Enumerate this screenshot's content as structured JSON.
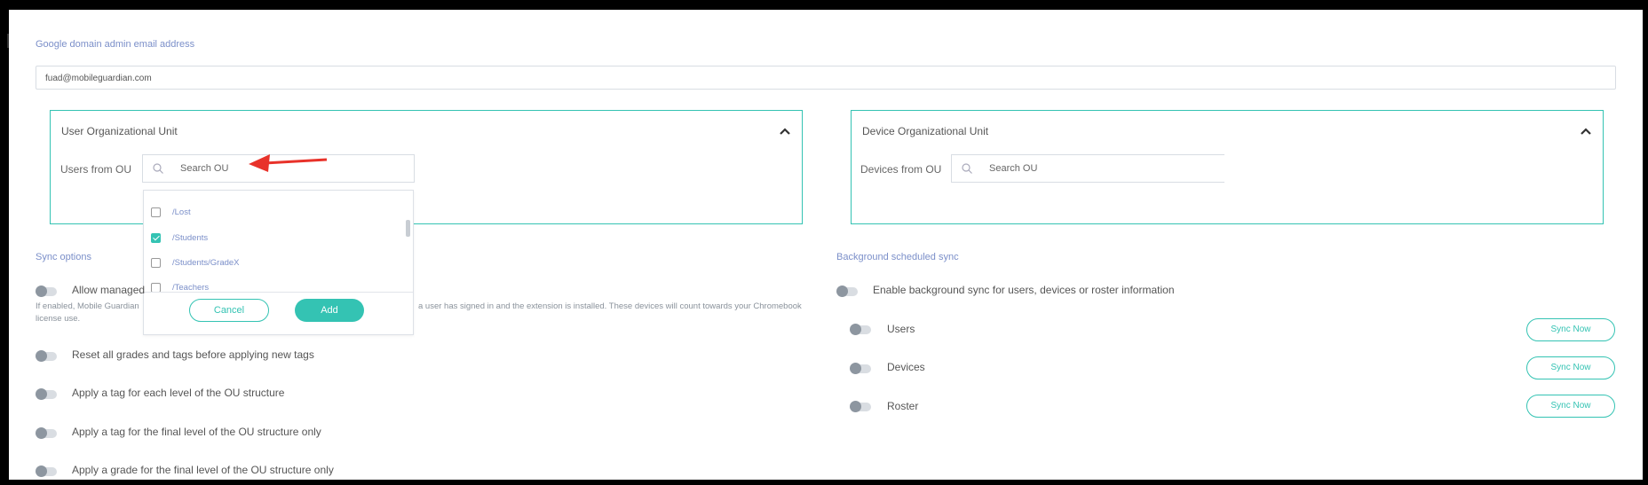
{
  "google": {
    "email_label": "Google domain admin email address",
    "email_value": "fuad@mobileguardian.com"
  },
  "user_ou": {
    "title": "User Organizational Unit",
    "field_label": "Users from OU",
    "search_placeholder": "Search OU",
    "options": [
      {
        "label": "/Lost",
        "checked": false
      },
      {
        "label": "/Students",
        "checked": true
      },
      {
        "label": "/Students/GradeX",
        "checked": false
      },
      {
        "label": "/Teachers",
        "checked": false
      }
    ],
    "cancel_label": "Cancel",
    "add_label": "Add"
  },
  "device_ou": {
    "title": "Device Organizational Unit",
    "field_label": "Devices from OU",
    "search_placeholder": "Search OU"
  },
  "sync_options": {
    "title": "Sync options",
    "items": [
      {
        "label": "Allow managed",
        "description_left": "If enabled, Mobile Guardian",
        "description_right": "a user has signed in and the extension is installed. These devices will count towards your Chromebook",
        "description_line2": "license use."
      },
      {
        "label": "Reset all grades and tags before applying new tags"
      },
      {
        "label": "Apply a tag for each level of the OU structure"
      },
      {
        "label": "Apply a tag for the final level of the OU structure only"
      },
      {
        "label": "Apply a grade for the final level of the OU structure only"
      }
    ]
  },
  "background_sync": {
    "title": "Background scheduled sync",
    "enable_label": "Enable background sync for users, devices or roster information",
    "items": [
      {
        "label": "Users",
        "button": "Sync Now"
      },
      {
        "label": "Devices",
        "button": "Sync Now"
      },
      {
        "label": "Roster",
        "button": "Sync Now"
      }
    ]
  },
  "colors": {
    "accent": "#34c3b3",
    "label_blue": "#7b8fc9",
    "arrow": "#e8322a"
  },
  "icons": [
    "search-icon",
    "chevron-up-icon",
    "checkbox-icon",
    "toggle-icon",
    "arrow-annotation"
  ]
}
